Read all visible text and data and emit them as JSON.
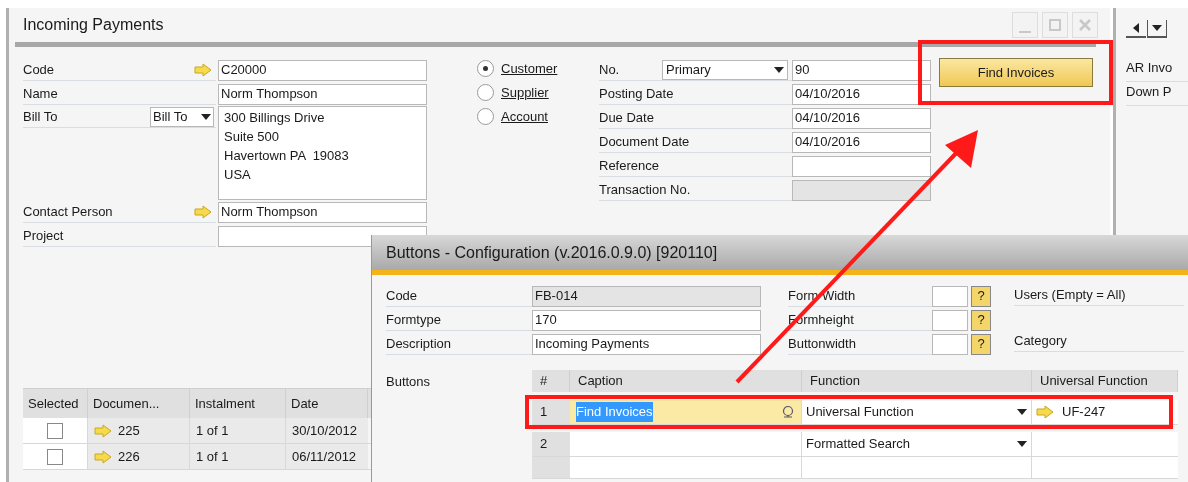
{
  "main_window": {
    "title": "Incoming Payments",
    "left_fields": [
      {
        "kind": "link",
        "label": "Code",
        "value": "C20000"
      },
      {
        "kind": "text",
        "label": "Name",
        "value": "Norm Thompson"
      },
      {
        "kind": "address",
        "label": "Bill To",
        "selector": "Bill To",
        "lines": [
          "300 Billings Drive",
          "Suite 500",
          "Havertown PA  19083",
          "USA"
        ]
      },
      {
        "kind": "link",
        "label": "Contact Person",
        "value": "Norm Thompson"
      },
      {
        "kind": "text",
        "label": "Project"
      }
    ],
    "partner_types": [
      {
        "label": "Customer",
        "selected": true
      },
      {
        "label": "Supplier",
        "selected": false
      },
      {
        "label": "Account",
        "selected": false
      }
    ],
    "right_fields": [
      {
        "label": "No.",
        "series": "Primary",
        "value": "90",
        "disabled": false
      },
      {
        "label": "Posting Date",
        "value": "04/10/2016",
        "disabled": false
      },
      {
        "label": "Due Date",
        "value": "04/10/2016",
        "disabled": false
      },
      {
        "label": "Document Date",
        "value": "04/10/2016",
        "disabled": false
      },
      {
        "label": "Reference",
        "disabled": false
      },
      {
        "label": "Transaction No.",
        "disabled": true
      }
    ],
    "find_button": "Find Invoices",
    "side_panel": {
      "items": [
        "AR Invo",
        "Down P"
      ]
    },
    "table": {
      "columns": [
        "Selected",
        "Documen...",
        "Instalment",
        "Date"
      ],
      "rows": [
        {
          "checked": false,
          "document": "225",
          "instalment": "1 of 1",
          "date": "30/10/2012"
        },
        {
          "checked": false,
          "document": "226",
          "instalment": "1 of 1",
          "date": "06/11/2012"
        }
      ]
    }
  },
  "dialog": {
    "title": "Buttons - Configuration (v.2016.0.9.0) [920110]",
    "fields": [
      {
        "label": "Code",
        "value": "FB-014",
        "disabled": true
      },
      {
        "label": "Formtype",
        "value": "170",
        "disabled": false
      },
      {
        "label": "Description",
        "value": "Incoming Payments",
        "disabled": false
      }
    ],
    "size_fields": [
      {
        "label": "Form Width",
        "help": "?"
      },
      {
        "label": "Formheight",
        "help": "?"
      },
      {
        "label": "Buttonwidth",
        "help": "?"
      }
    ],
    "side_labels": [
      "Users (Empty = All)",
      "Category"
    ],
    "grid_label": "Buttons",
    "grid": {
      "columns": [
        "#",
        "Caption",
        "Function",
        "Universal Function"
      ],
      "rows": [
        {
          "number": "1",
          "caption": "Find Invoices",
          "function": "Universal Function",
          "universal_function": "UF-247",
          "selected": true
        },
        {
          "number": "2",
          "function": "Formatted Search",
          "selected": false
        }
      ]
    }
  }
}
